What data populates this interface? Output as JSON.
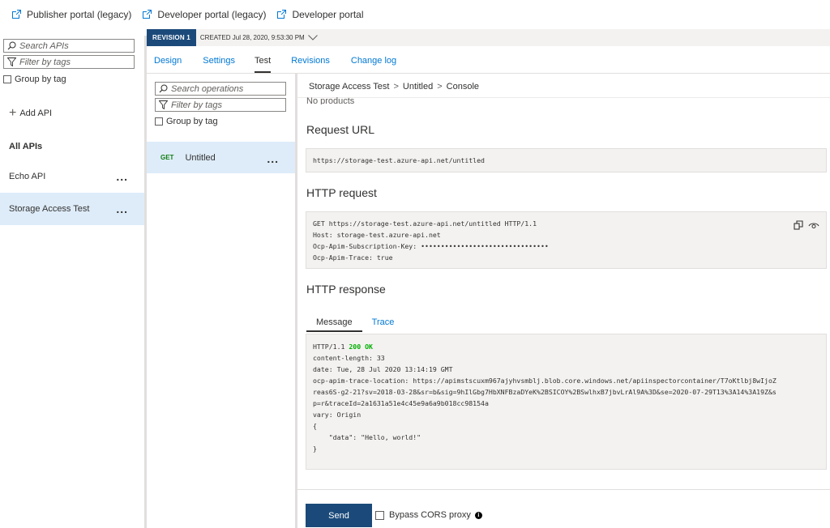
{
  "portal_links": [
    {
      "label": "Publisher portal (legacy)"
    },
    {
      "label": "Developer portal (legacy)"
    },
    {
      "label": "Developer portal"
    }
  ],
  "left_panel": {
    "search_placeholder": "Search APIs",
    "filter_placeholder": "Filter by tags",
    "group_by_tag": "Group by tag",
    "add_api": "Add API",
    "all_apis_header": "All APIs",
    "apis": [
      {
        "name": "Echo API",
        "selected": false
      },
      {
        "name": "Storage Access Test",
        "selected": true
      }
    ],
    "more": "..."
  },
  "revision": {
    "badge": "REVISION 1",
    "created": "CREATED Jul 28, 2020, 9:53:30 PM"
  },
  "tabs": [
    {
      "label": "Design"
    },
    {
      "label": "Settings"
    },
    {
      "label": "Test",
      "active": true
    },
    {
      "label": "Revisions"
    },
    {
      "label": "Change log"
    }
  ],
  "operations": {
    "search_placeholder": "Search operations",
    "filter_placeholder": "Filter by tags",
    "group_by_tag": "Group by tag",
    "items": [
      {
        "method": "GET",
        "name": "Untitled"
      }
    ],
    "more": "..."
  },
  "console": {
    "breadcrumb": [
      "Storage Access Test",
      "Untitled",
      "Console"
    ],
    "breadcrumb_sep": ">",
    "no_products": "No products",
    "request_url_title": "Request URL",
    "request_url": "https://storage-test.azure-api.net/untitled",
    "http_request_title": "HTTP request",
    "http_request_lines": [
      "GET https://storage-test.azure-api.net/untitled HTTP/1.1",
      "Host: storage-test.azure-api.net",
      "Ocp-Apim-Subscription-Key: ••••••••••••••••••••••••••••••••",
      "Ocp-Apim-Trace: true"
    ],
    "http_response_title": "HTTP response",
    "response_tabs": [
      {
        "label": "Message",
        "active": true
      },
      {
        "label": "Trace"
      }
    ],
    "response_status_prefix": "HTTP/1.1 ",
    "response_status_code": "200 OK",
    "response_lines": [
      "",
      "content-length: 33",
      "date: Tue, 28 Jul 2020 13:14:19 GMT",
      "ocp-apim-trace-location: https://apimstscuxm967ajyhvsmblj.blob.core.windows.net/apiinspectorcontainer/T7oKtlbj8wIjoZ",
      "reas6S-g2-21?sv=2018-03-28&sr=b&sig=9hIlGbg7HbXNFBzaDYeK%2BSICOY%2BSwlhxB7jbvLrAl9A%3D&se=2020-07-29T13%3A14%3A19Z&s",
      "p=r&traceId=2a1631a51e4c45e9a6a9b018cc98154a",
      "vary: Origin",
      "{",
      "    \"data\": \"Hello, world!\"",
      "}"
    ],
    "send_label": "Send",
    "bypass_cors": "Bypass CORS proxy"
  },
  "colors": {
    "accent": "#0078d4",
    "primary_button": "#1b4a7a",
    "selected_bg": "#deecf9",
    "status_ok": "#00b000",
    "get_method": "#107c10"
  }
}
